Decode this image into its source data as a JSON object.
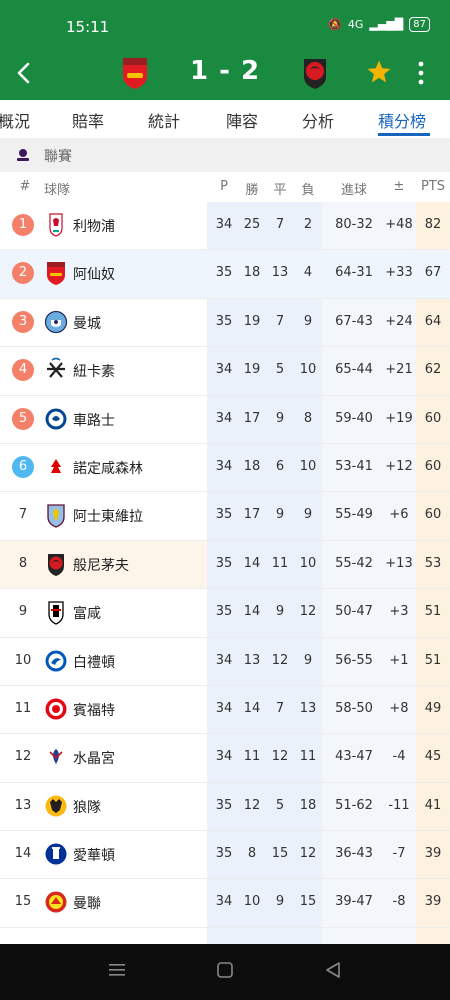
{
  "status": {
    "time": "15:11",
    "network": "4G",
    "battery": "87"
  },
  "match": {
    "score": "1 - 2",
    "home_team": "Arsenal",
    "away_team": "Bournemouth"
  },
  "tabs": [
    "概況",
    "賠率",
    "統計",
    "陣容",
    "分析",
    "積分榜"
  ],
  "active_tab": "積分榜",
  "league": {
    "label": "聯賽"
  },
  "columns": {
    "pos": "#",
    "team": "球隊",
    "played": "P",
    "won": "勝",
    "drawn": "平",
    "lost": "負",
    "goals": "進球",
    "diff": "±",
    "pts": "PTS"
  },
  "colors": {
    "header_green": "#1b8a41",
    "cl_zone": "#f5806a",
    "el_zone": "#4fb8f0",
    "active_tab": "#1565c0",
    "star": "#f5b400"
  },
  "standings": [
    {
      "pos": "1",
      "team": "利物浦",
      "p": "34",
      "w": "25",
      "d": "7",
      "l": "2",
      "goals": "80-32",
      "gd": "+48",
      "pts": "82",
      "crest": "liverpool-crest-icon"
    },
    {
      "pos": "2",
      "team": "阿仙奴",
      "p": "35",
      "w": "18",
      "d": "13",
      "l": "4",
      "goals": "64-31",
      "gd": "+33",
      "pts": "67",
      "crest": "arsenal-crest-icon"
    },
    {
      "pos": "3",
      "team": "曼城",
      "p": "35",
      "w": "19",
      "d": "7",
      "l": "9",
      "goals": "67-43",
      "gd": "+24",
      "pts": "64",
      "crest": "man-city-crest-icon"
    },
    {
      "pos": "4",
      "team": "紐卡素",
      "p": "34",
      "w": "19",
      "d": "5",
      "l": "10",
      "goals": "65-44",
      "gd": "+21",
      "pts": "62",
      "crest": "newcastle-crest-icon"
    },
    {
      "pos": "5",
      "team": "車路士",
      "p": "34",
      "w": "17",
      "d": "9",
      "l": "8",
      "goals": "59-40",
      "gd": "+19",
      "pts": "60",
      "crest": "chelsea-crest-icon"
    },
    {
      "pos": "6",
      "team": "諾定咸森林",
      "p": "34",
      "w": "18",
      "d": "6",
      "l": "10",
      "goals": "53-41",
      "gd": "+12",
      "pts": "60",
      "crest": "nottingham-forest-crest-icon"
    },
    {
      "pos": "7",
      "team": "阿士東維拉",
      "p": "35",
      "w": "17",
      "d": "9",
      "l": "9",
      "goals": "55-49",
      "gd": "+6",
      "pts": "60",
      "crest": "aston-villa-crest-icon"
    },
    {
      "pos": "8",
      "team": "般尼茅夫",
      "p": "35",
      "w": "14",
      "d": "11",
      "l": "10",
      "goals": "55-42",
      "gd": "+13",
      "pts": "53",
      "crest": "bournemouth-crest-icon"
    },
    {
      "pos": "9",
      "team": "富咸",
      "p": "35",
      "w": "14",
      "d": "9",
      "l": "12",
      "goals": "50-47",
      "gd": "+3",
      "pts": "51",
      "crest": "fulham-crest-icon"
    },
    {
      "pos": "10",
      "team": "白禮頓",
      "p": "34",
      "w": "13",
      "d": "12",
      "l": "9",
      "goals": "56-55",
      "gd": "+1",
      "pts": "51",
      "crest": "brighton-crest-icon"
    },
    {
      "pos": "11",
      "team": "賓福特",
      "p": "34",
      "w": "14",
      "d": "7",
      "l": "13",
      "goals": "58-50",
      "gd": "+8",
      "pts": "49",
      "crest": "brentford-crest-icon"
    },
    {
      "pos": "12",
      "team": "水晶宮",
      "p": "34",
      "w": "11",
      "d": "12",
      "l": "11",
      "goals": "43-47",
      "gd": "-4",
      "pts": "45",
      "crest": "crystal-palace-crest-icon"
    },
    {
      "pos": "13",
      "team": "狼隊",
      "p": "35",
      "w": "12",
      "d": "5",
      "l": "18",
      "goals": "51-62",
      "gd": "-11",
      "pts": "41",
      "crest": "wolves-crest-icon"
    },
    {
      "pos": "14",
      "team": "愛華頓",
      "p": "35",
      "w": "8",
      "d": "15",
      "l": "12",
      "goals": "36-43",
      "gd": "-7",
      "pts": "39",
      "crest": "everton-crest-icon"
    },
    {
      "pos": "15",
      "team": "曼聯",
      "p": "34",
      "w": "10",
      "d": "9",
      "l": "15",
      "goals": "39-47",
      "gd": "-8",
      "pts": "39",
      "crest": "man-united-crest-icon"
    }
  ]
}
